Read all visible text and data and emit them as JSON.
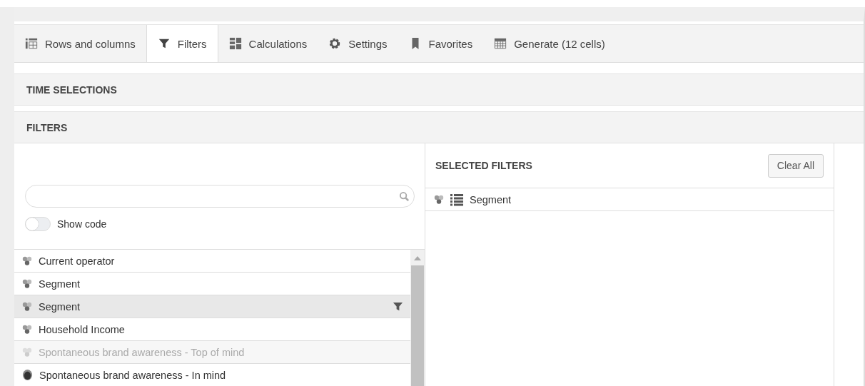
{
  "tabs": [
    {
      "label": "Rows and columns",
      "kind": "rows",
      "selected": false
    },
    {
      "label": "Filters",
      "kind": "filter",
      "selected": true
    },
    {
      "label": "Calculations",
      "kind": "calc",
      "selected": false
    },
    {
      "label": "Settings",
      "kind": "gear",
      "selected": false
    },
    {
      "label": "Favorites",
      "kind": "bookmark",
      "selected": false
    },
    {
      "label": "Generate (12 cells)",
      "kind": "table",
      "selected": false
    }
  ],
  "sections": [
    {
      "title": "TIME SELECTIONS"
    },
    {
      "title": "FILTERS"
    }
  ],
  "filter_panel": {
    "show_code": {
      "label": "Show code",
      "on": false
    },
    "items": [
      {
        "label": "Current operator",
        "kind": "variable",
        "selected": false,
        "disabled": false,
        "filtered": false
      },
      {
        "label": "Segment",
        "kind": "variable",
        "selected": false,
        "disabled": false,
        "filtered": false
      },
      {
        "label": "Segment",
        "kind": "variable",
        "selected": true,
        "disabled": false,
        "filtered": true
      },
      {
        "label": "Household Income",
        "kind": "variable",
        "selected": false,
        "disabled": false,
        "filtered": false
      },
      {
        "label": "Spontaneous brand awareness - Top of mind",
        "kind": "variable",
        "selected": false,
        "disabled": true,
        "filtered": false
      },
      {
        "label": "Spontaneous brand awareness - In mind",
        "kind": "blob",
        "selected": false,
        "disabled": false,
        "filtered": false
      }
    ]
  },
  "selected_filters": {
    "title": "SELECTED FILTERS",
    "clear_button": "Clear All",
    "items": [
      {
        "label": "Segment"
      }
    ]
  }
}
